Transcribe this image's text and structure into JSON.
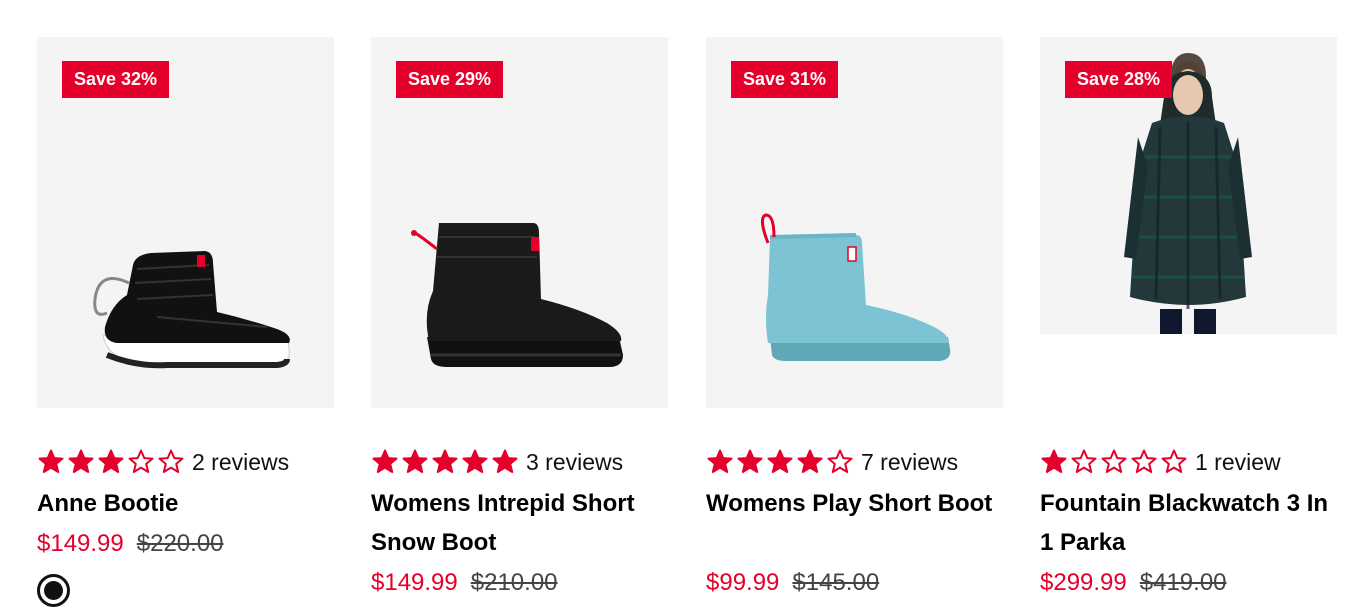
{
  "colors": {
    "accent": "#e4002b",
    "star": "#e4002b",
    "card_bg": "#f4f4f4"
  },
  "products": [
    {
      "badge": "Save 32%",
      "rating": 3,
      "reviews": "2 reviews",
      "name": "Anne Bootie",
      "sale_price": "$149.99",
      "original_price": "$220.00",
      "swatch_color": "black"
    },
    {
      "badge": "Save 29%",
      "rating": 5,
      "reviews": "3 reviews",
      "name": "Womens Intrepid Short Snow Boot",
      "sale_price": "$149.99",
      "original_price": "$210.00"
    },
    {
      "badge": "Save 31%",
      "rating": 4,
      "reviews": "7 reviews",
      "name": "Womens Play Short Boot",
      "sale_price": "$99.99",
      "original_price": "$145.00"
    },
    {
      "badge": "Save 28%",
      "rating": 1,
      "reviews": "1 review",
      "name": "Fountain Blackwatch 3 In 1 Parka",
      "sale_price": "$299.99",
      "original_price": "$419.00"
    }
  ]
}
